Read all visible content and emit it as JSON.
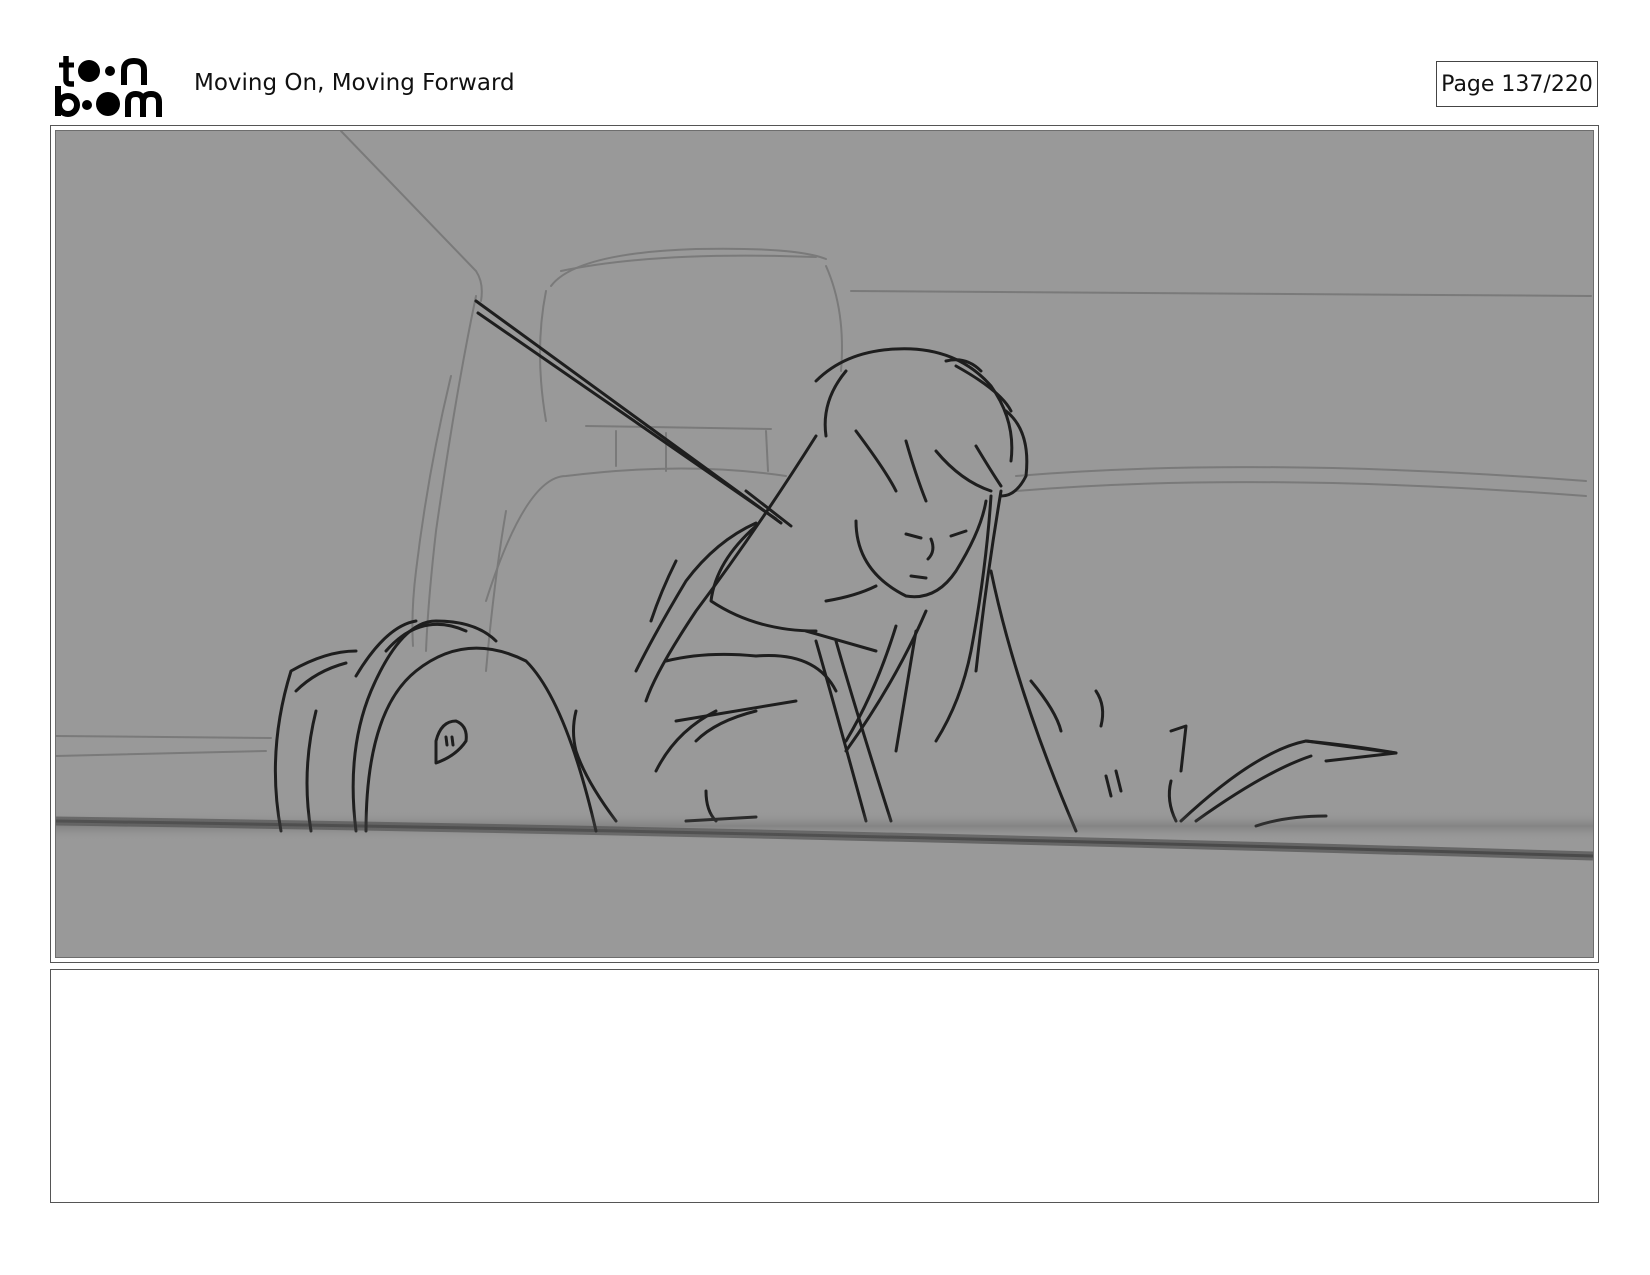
{
  "header": {
    "logo_text": "toon boom",
    "title": "Moving On, Moving Forward",
    "page_label": "Page 137/220"
  },
  "panel": {
    "image_icon": "storyboard-sketch-girl-in-car-seat",
    "background_color": "#999999"
  },
  "notes": {
    "text": ""
  }
}
